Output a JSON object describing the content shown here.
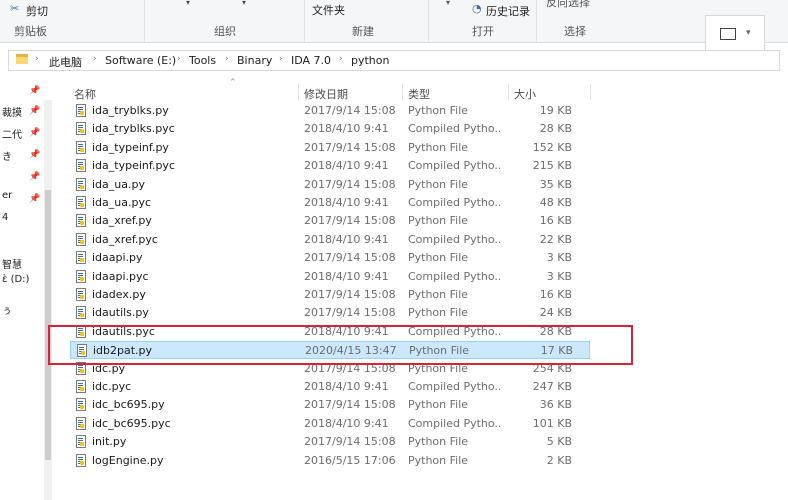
{
  "ribbon": {
    "cut_label": "剪切",
    "clipboard_label": "剪贴板",
    "organize_label": "组织",
    "new_label": "新建",
    "new_folder_label": "文件夹",
    "open_label": "打开",
    "history_label": "历史记录",
    "select_label": "选择",
    "invert_label": "反向选择"
  },
  "address": {
    "crumbs": [
      "此电脑",
      "Software (E:)",
      "Tools",
      "Binary",
      "IDA 7.0",
      "python"
    ]
  },
  "nav": {
    "items": [
      "裁摸",
      "二代",
      "き",
      "er",
      "4",
      "智慧",
      "ὲ (D:)",
      "ぅ"
    ]
  },
  "columns": {
    "name": "名称",
    "date": "修改日期",
    "type": "类型",
    "size": "大小"
  },
  "files": [
    {
      "name": "ida_tryblks.py",
      "date": "2017/9/14 15:08",
      "type": "Python File",
      "size": "19 KB"
    },
    {
      "name": "ida_tryblks.pyc",
      "date": "2018/4/10 9:41",
      "type": "Compiled Pytho...",
      "size": "28 KB"
    },
    {
      "name": "ida_typeinf.py",
      "date": "2017/9/14 15:08",
      "type": "Python File",
      "size": "152 KB"
    },
    {
      "name": "ida_typeinf.pyc",
      "date": "2018/4/10 9:41",
      "type": "Compiled Pytho...",
      "size": "215 KB"
    },
    {
      "name": "ida_ua.py",
      "date": "2017/9/14 15:08",
      "type": "Python File",
      "size": "35 KB"
    },
    {
      "name": "ida_ua.pyc",
      "date": "2018/4/10 9:41",
      "type": "Compiled Pytho...",
      "size": "48 KB"
    },
    {
      "name": "ida_xref.py",
      "date": "2017/9/14 15:08",
      "type": "Python File",
      "size": "16 KB"
    },
    {
      "name": "ida_xref.pyc",
      "date": "2018/4/10 9:41",
      "type": "Compiled Pytho...",
      "size": "22 KB"
    },
    {
      "name": "idaapi.py",
      "date": "2017/9/14 15:08",
      "type": "Python File",
      "size": "3 KB"
    },
    {
      "name": "idaapi.pyc",
      "date": "2018/4/10 9:41",
      "type": "Compiled Pytho...",
      "size": "3 KB"
    },
    {
      "name": "idadex.py",
      "date": "2017/9/14 15:08",
      "type": "Python File",
      "size": "16 KB"
    },
    {
      "name": "idautils.py",
      "date": "2017/9/14 15:08",
      "type": "Python File",
      "size": "24 KB"
    },
    {
      "name": "idautils.pyc",
      "date": "2018/4/10 9:41",
      "type": "Compiled Pytho...",
      "size": "28 KB"
    },
    {
      "name": "idb2pat.py",
      "date": "2020/4/15 13:47",
      "type": "Python File",
      "size": "17 KB",
      "selected": true
    },
    {
      "name": "idc.py",
      "date": "2017/9/14 15:08",
      "type": "Python File",
      "size": "254 KB"
    },
    {
      "name": "idc.pyc",
      "date": "2018/4/10 9:41",
      "type": "Compiled Pytho...",
      "size": "247 KB"
    },
    {
      "name": "idc_bc695.py",
      "date": "2017/9/14 15:08",
      "type": "Python File",
      "size": "36 KB"
    },
    {
      "name": "idc_bc695.pyc",
      "date": "2018/4/10 9:41",
      "type": "Compiled Pytho...",
      "size": "101 KB"
    },
    {
      "name": "init.py",
      "date": "2017/9/14 15:08",
      "type": "Python File",
      "size": "5 KB"
    },
    {
      "name": "logEngine.py",
      "date": "2016/5/15 17:06",
      "type": "Python File",
      "size": "2 KB"
    }
  ],
  "colors": {
    "selection_bg": "#cce8ff",
    "highlight_box": "#d6243b"
  },
  "icons": {
    "file": "python-file-icon",
    "pin": "pin-icon"
  }
}
